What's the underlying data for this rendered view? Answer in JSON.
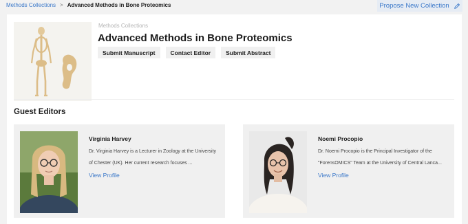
{
  "breadcrumb": {
    "parent": "Methods Collections",
    "separator": ">",
    "current": "Advanced Methods in Bone Proteomics"
  },
  "propose_button": {
    "label": "Propose New Collection",
    "icon": "pencil-icon"
  },
  "collection": {
    "kicker": "Methods Collections",
    "title": "Advanced Methods in Bone Proteomics",
    "actions": [
      "Submit Manuscript",
      "Contact Editor",
      "Submit Abstract"
    ]
  },
  "guest_editors": {
    "heading": "Guest Editors",
    "editors": [
      {
        "name": "Virginia Harvey",
        "bio_line1": "Dr. Virginia Harvey is a Lecturer in Zoology at the University",
        "bio_line2": "of Chester (UK). Her current research focuses ...",
        "link": "View Profile"
      },
      {
        "name": "Noemi Procopio",
        "bio_line1": "Dr. Noemi Procopio is the Principal Investigator of the",
        "bio_line2": "\"ForensOMICS\" Team at the University of Central Lanca...",
        "link": "View Profile"
      }
    ]
  },
  "colors": {
    "link": "#3a78c9",
    "card_bg": "#f0f0f0",
    "page_bg": "#f2f2f2"
  }
}
